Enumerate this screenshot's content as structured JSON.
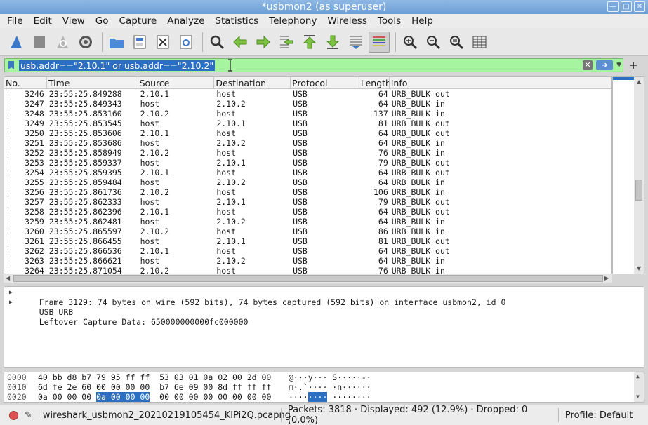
{
  "window": {
    "title": "*usbmon2 (as superuser)"
  },
  "menu": [
    "File",
    "Edit",
    "View",
    "Go",
    "Capture",
    "Analyze",
    "Statistics",
    "Telephony",
    "Wireless",
    "Tools",
    "Help"
  ],
  "filter": {
    "value": "usb.addr==\"2.10.1\" or usb.addr==\"2.10.2\""
  },
  "packet_list": {
    "columns": [
      "No.",
      "Time",
      "Source",
      "Destination",
      "Protocol",
      "Length",
      "Info"
    ],
    "rows": [
      [
        "3246",
        "23:55:25.849288",
        "2.10.1",
        "host",
        "USB",
        "64",
        "URB_BULK out"
      ],
      [
        "3247",
        "23:55:25.849343",
        "host",
        "2.10.2",
        "USB",
        "64",
        "URB_BULK in"
      ],
      [
        "3248",
        "23:55:25.853160",
        "2.10.2",
        "host",
        "USB",
        "137",
        "URB_BULK in"
      ],
      [
        "3249",
        "23:55:25.853545",
        "host",
        "2.10.1",
        "USB",
        "81",
        "URB_BULK out"
      ],
      [
        "3250",
        "23:55:25.853606",
        "2.10.1",
        "host",
        "USB",
        "64",
        "URB_BULK out"
      ],
      [
        "3251",
        "23:55:25.853686",
        "host",
        "2.10.2",
        "USB",
        "64",
        "URB_BULK in"
      ],
      [
        "3252",
        "23:55:25.858949",
        "2.10.2",
        "host",
        "USB",
        "76",
        "URB_BULK in"
      ],
      [
        "3253",
        "23:55:25.859337",
        "host",
        "2.10.1",
        "USB",
        "79",
        "URB_BULK out"
      ],
      [
        "3254",
        "23:55:25.859395",
        "2.10.1",
        "host",
        "USB",
        "64",
        "URB_BULK out"
      ],
      [
        "3255",
        "23:55:25.859484",
        "host",
        "2.10.2",
        "USB",
        "64",
        "URB_BULK in"
      ],
      [
        "3256",
        "23:55:25.861736",
        "2.10.2",
        "host",
        "USB",
        "106",
        "URB_BULK in"
      ],
      [
        "3257",
        "23:55:25.862333",
        "host",
        "2.10.1",
        "USB",
        "79",
        "URB_BULK out"
      ],
      [
        "3258",
        "23:55:25.862396",
        "2.10.1",
        "host",
        "USB",
        "64",
        "URB_BULK out"
      ],
      [
        "3259",
        "23:55:25.862481",
        "host",
        "2.10.2",
        "USB",
        "64",
        "URB_BULK in"
      ],
      [
        "3260",
        "23:55:25.865597",
        "2.10.2",
        "host",
        "USB",
        "86",
        "URB_BULK in"
      ],
      [
        "3261",
        "23:55:25.866455",
        "host",
        "2.10.1",
        "USB",
        "81",
        "URB_BULK out"
      ],
      [
        "3262",
        "23:55:25.866536",
        "2.10.1",
        "host",
        "USB",
        "64",
        "URB_BULK out"
      ],
      [
        "3263",
        "23:55:25.866621",
        "host",
        "2.10.2",
        "USB",
        "64",
        "URB_BULK in"
      ],
      [
        "3264",
        "23:55:25.871054",
        "2.10.2",
        "host",
        "USB",
        "76",
        "URB_BULK in"
      ]
    ]
  },
  "details": {
    "frame": "Frame 3129: 74 bytes on wire (592 bits), 74 bytes captured (592 bits) on interface usbmon2, id 0",
    "usb_urb": "USB URB",
    "leftover": "Leftover Capture Data: 650000000000fc000000"
  },
  "hex": [
    {
      "offset": "0000",
      "bytes_a": "40 bb d8 b7 79 95 ff ff",
      "bytes_b": "53 03 01 0a 02 00 2d 00",
      "ascii": "@···y··· S·····-·"
    },
    {
      "offset": "0010",
      "bytes_a": "6d fe 2e 60 00 00 00 00",
      "bytes_b": "b7 6e 09 00 8d ff ff ff",
      "ascii": "m·.`···· ·n······"
    },
    {
      "offset": "0020",
      "bytes_pre": "0a 00 00 00",
      "bytes_hl": "0a 00 00 00",
      "bytes_b": "00 00 00 00 00 00 00 00",
      "ascii_pre": "····",
      "ascii_hl": "····",
      "ascii_post": "········"
    }
  ],
  "status": {
    "file": "wireshark_usbmon2_20210219105454_KIPi2Q.pcapng",
    "packets": "Packets: 3818 · Displayed: 492 (12.9%) · Dropped: 0 (0.0%)",
    "profile": "Profile: Default"
  },
  "colors": {
    "accent": "#2c6fc2",
    "filter_bg": "#a6f3a0"
  }
}
